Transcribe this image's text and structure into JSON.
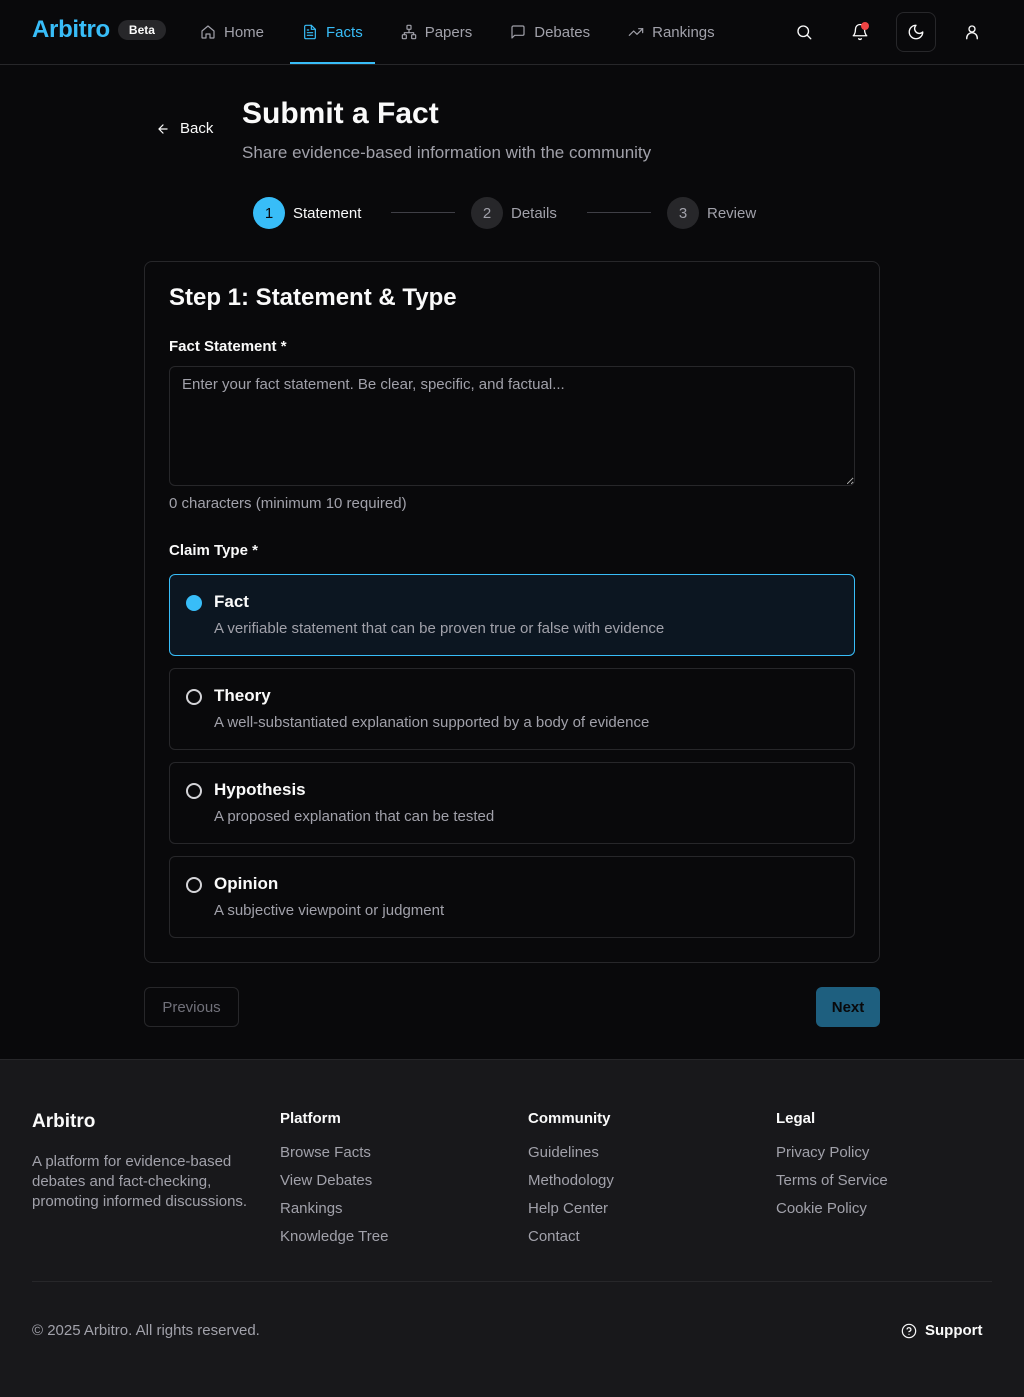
{
  "brand": {
    "name": "Arbitro",
    "badge": "Beta"
  },
  "nav": {
    "items": [
      {
        "label": "Home",
        "icon": "home-icon"
      },
      {
        "label": "Facts",
        "icon": "document-icon",
        "active": true
      },
      {
        "label": "Papers",
        "icon": "network-icon"
      },
      {
        "label": "Debates",
        "icon": "chat-icon"
      },
      {
        "label": "Rankings",
        "icon": "trending-up-icon"
      }
    ]
  },
  "header_actions": [
    "search-icon",
    "bell-icon",
    "moon-icon",
    "user-icon"
  ],
  "page": {
    "back_label": "Back",
    "title": "Submit a Fact",
    "subtitle": "Share evidence-based information with the community"
  },
  "stepper": {
    "steps": [
      {
        "number": "1",
        "label": "Statement",
        "active": true
      },
      {
        "number": "2",
        "label": "Details"
      },
      {
        "number": "3",
        "label": "Review"
      }
    ]
  },
  "form": {
    "title": "Step 1: Statement & Type",
    "statement_label": "Fact Statement *",
    "statement_value": "",
    "statement_placeholder": "Enter your fact statement. Be clear, specific, and factual...",
    "char_count": "0 characters (minimum 10 required)",
    "claim_type_label": "Claim Type *",
    "claim_types": [
      {
        "title": "Fact",
        "description": "A verifiable statement that can be proven true or false with evidence",
        "selected": true
      },
      {
        "title": "Theory",
        "description": "A well-substantiated explanation supported by a body of evidence"
      },
      {
        "title": "Hypothesis",
        "description": "A proposed explanation that can be tested"
      },
      {
        "title": "Opinion",
        "description": "A subjective viewpoint or judgment"
      }
    ],
    "previous_label": "Previous",
    "next_label": "Next"
  },
  "footer": {
    "brand": "Arbitro",
    "description": "A platform for evidence-based debates and fact-checking, promoting informed discussions.",
    "columns": [
      {
        "title": "Platform",
        "links": [
          "Browse Facts",
          "View Debates",
          "Rankings",
          "Knowledge Tree"
        ]
      },
      {
        "title": "Community",
        "links": [
          "Guidelines",
          "Methodology",
          "Help Center",
          "Contact"
        ]
      },
      {
        "title": "Legal",
        "links": [
          "Privacy Policy",
          "Terms of Service",
          "Cookie Policy"
        ]
      }
    ],
    "copyright": "© 2025 Arbitro. All rights reserved.",
    "support_label": "Support"
  },
  "colors": {
    "accent": "#38bdf8",
    "background": "#09090b",
    "footer_background": "#18181b",
    "border": "#27272a",
    "muted_text": "#a1a1aa",
    "notification_dot": "#ef4444"
  }
}
